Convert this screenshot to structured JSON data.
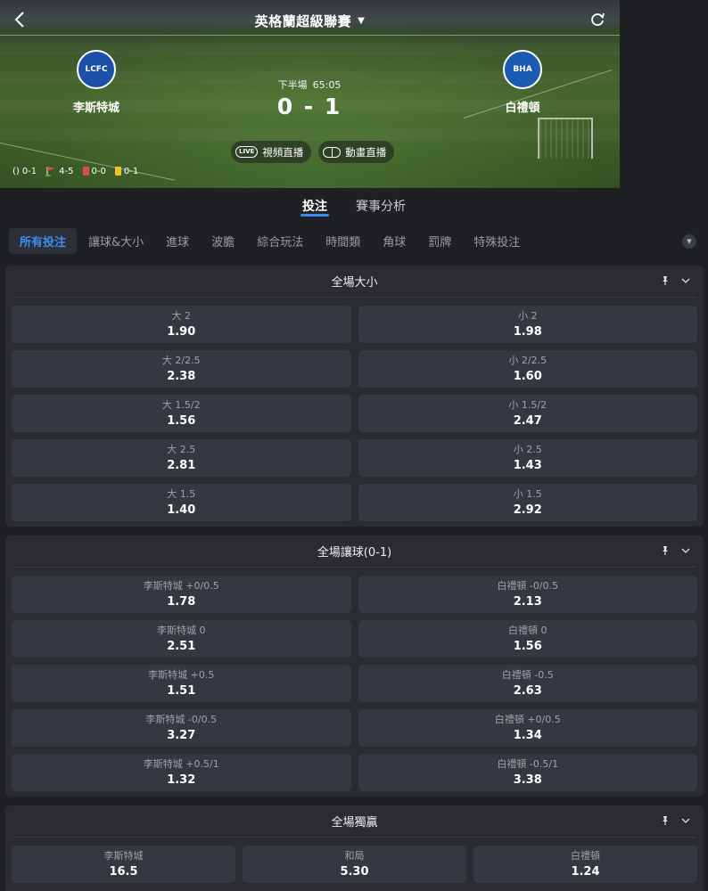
{
  "header": {
    "league": "英格蘭超級聯賽",
    "home_team": "李斯特城",
    "away_team": "白禮頓",
    "home_crest_text": "LCFC",
    "away_crest_text": "BHA",
    "phase": "下半場",
    "clock": "65:05",
    "score": "0 - 1",
    "video_live": "視頻直播",
    "video_badge": "LIVE",
    "animation_live": "動畫直播",
    "stats": {
      "penalty": "0-1",
      "corners": "4-5",
      "red_cards": "0-0",
      "yellow_cards": "0-1"
    }
  },
  "main_tabs": [
    "投注",
    "賽事分析"
  ],
  "sub_tabs": [
    "所有投注",
    "讓球&大小",
    "進球",
    "波膽",
    "綜合玩法",
    "時間類",
    "角球",
    "罰牌",
    "特殊投注"
  ],
  "markets": [
    {
      "title": "全場大小",
      "rows": [
        [
          {
            "label": "大 2",
            "odds": "1.90"
          },
          {
            "label": "小 2",
            "odds": "1.98"
          }
        ],
        [
          {
            "label": "大 2/2.5",
            "odds": "2.38"
          },
          {
            "label": "小 2/2.5",
            "odds": "1.60"
          }
        ],
        [
          {
            "label": "大 1.5/2",
            "odds": "1.56"
          },
          {
            "label": "小 1.5/2",
            "odds": "2.47"
          }
        ],
        [
          {
            "label": "大 2.5",
            "odds": "2.81"
          },
          {
            "label": "小 2.5",
            "odds": "1.43"
          }
        ],
        [
          {
            "label": "大 1.5",
            "odds": "1.40"
          },
          {
            "label": "小 1.5",
            "odds": "2.92"
          }
        ]
      ]
    },
    {
      "title": "全場讓球(0-1)",
      "rows": [
        [
          {
            "label": "李斯特城 +0/0.5",
            "odds": "1.78"
          },
          {
            "label": "白禮頓 -0/0.5",
            "odds": "2.13"
          }
        ],
        [
          {
            "label": "李斯特城 0",
            "odds": "2.51"
          },
          {
            "label": "白禮頓 0",
            "odds": "1.56"
          }
        ],
        [
          {
            "label": "李斯特城 +0.5",
            "odds": "1.51"
          },
          {
            "label": "白禮頓 -0.5",
            "odds": "2.63"
          }
        ],
        [
          {
            "label": "李斯特城 -0/0.5",
            "odds": "3.27"
          },
          {
            "label": "白禮頓 +0/0.5",
            "odds": "1.34"
          }
        ],
        [
          {
            "label": "李斯特城 +0.5/1",
            "odds": "1.32"
          },
          {
            "label": "白禮頓 -0.5/1",
            "odds": "3.38"
          }
        ]
      ]
    },
    {
      "title": "全場獨贏",
      "rows": [
        [
          {
            "label": "李斯特城",
            "odds": "16.5"
          },
          {
            "label": "和局",
            "odds": "5.30"
          },
          {
            "label": "白禮頓",
            "odds": "1.24"
          }
        ]
      ]
    }
  ],
  "colors": {
    "accent": "#3b8cf5",
    "background": "#1e2024",
    "panel": "#2a2c31",
    "cell": "#35383e"
  }
}
